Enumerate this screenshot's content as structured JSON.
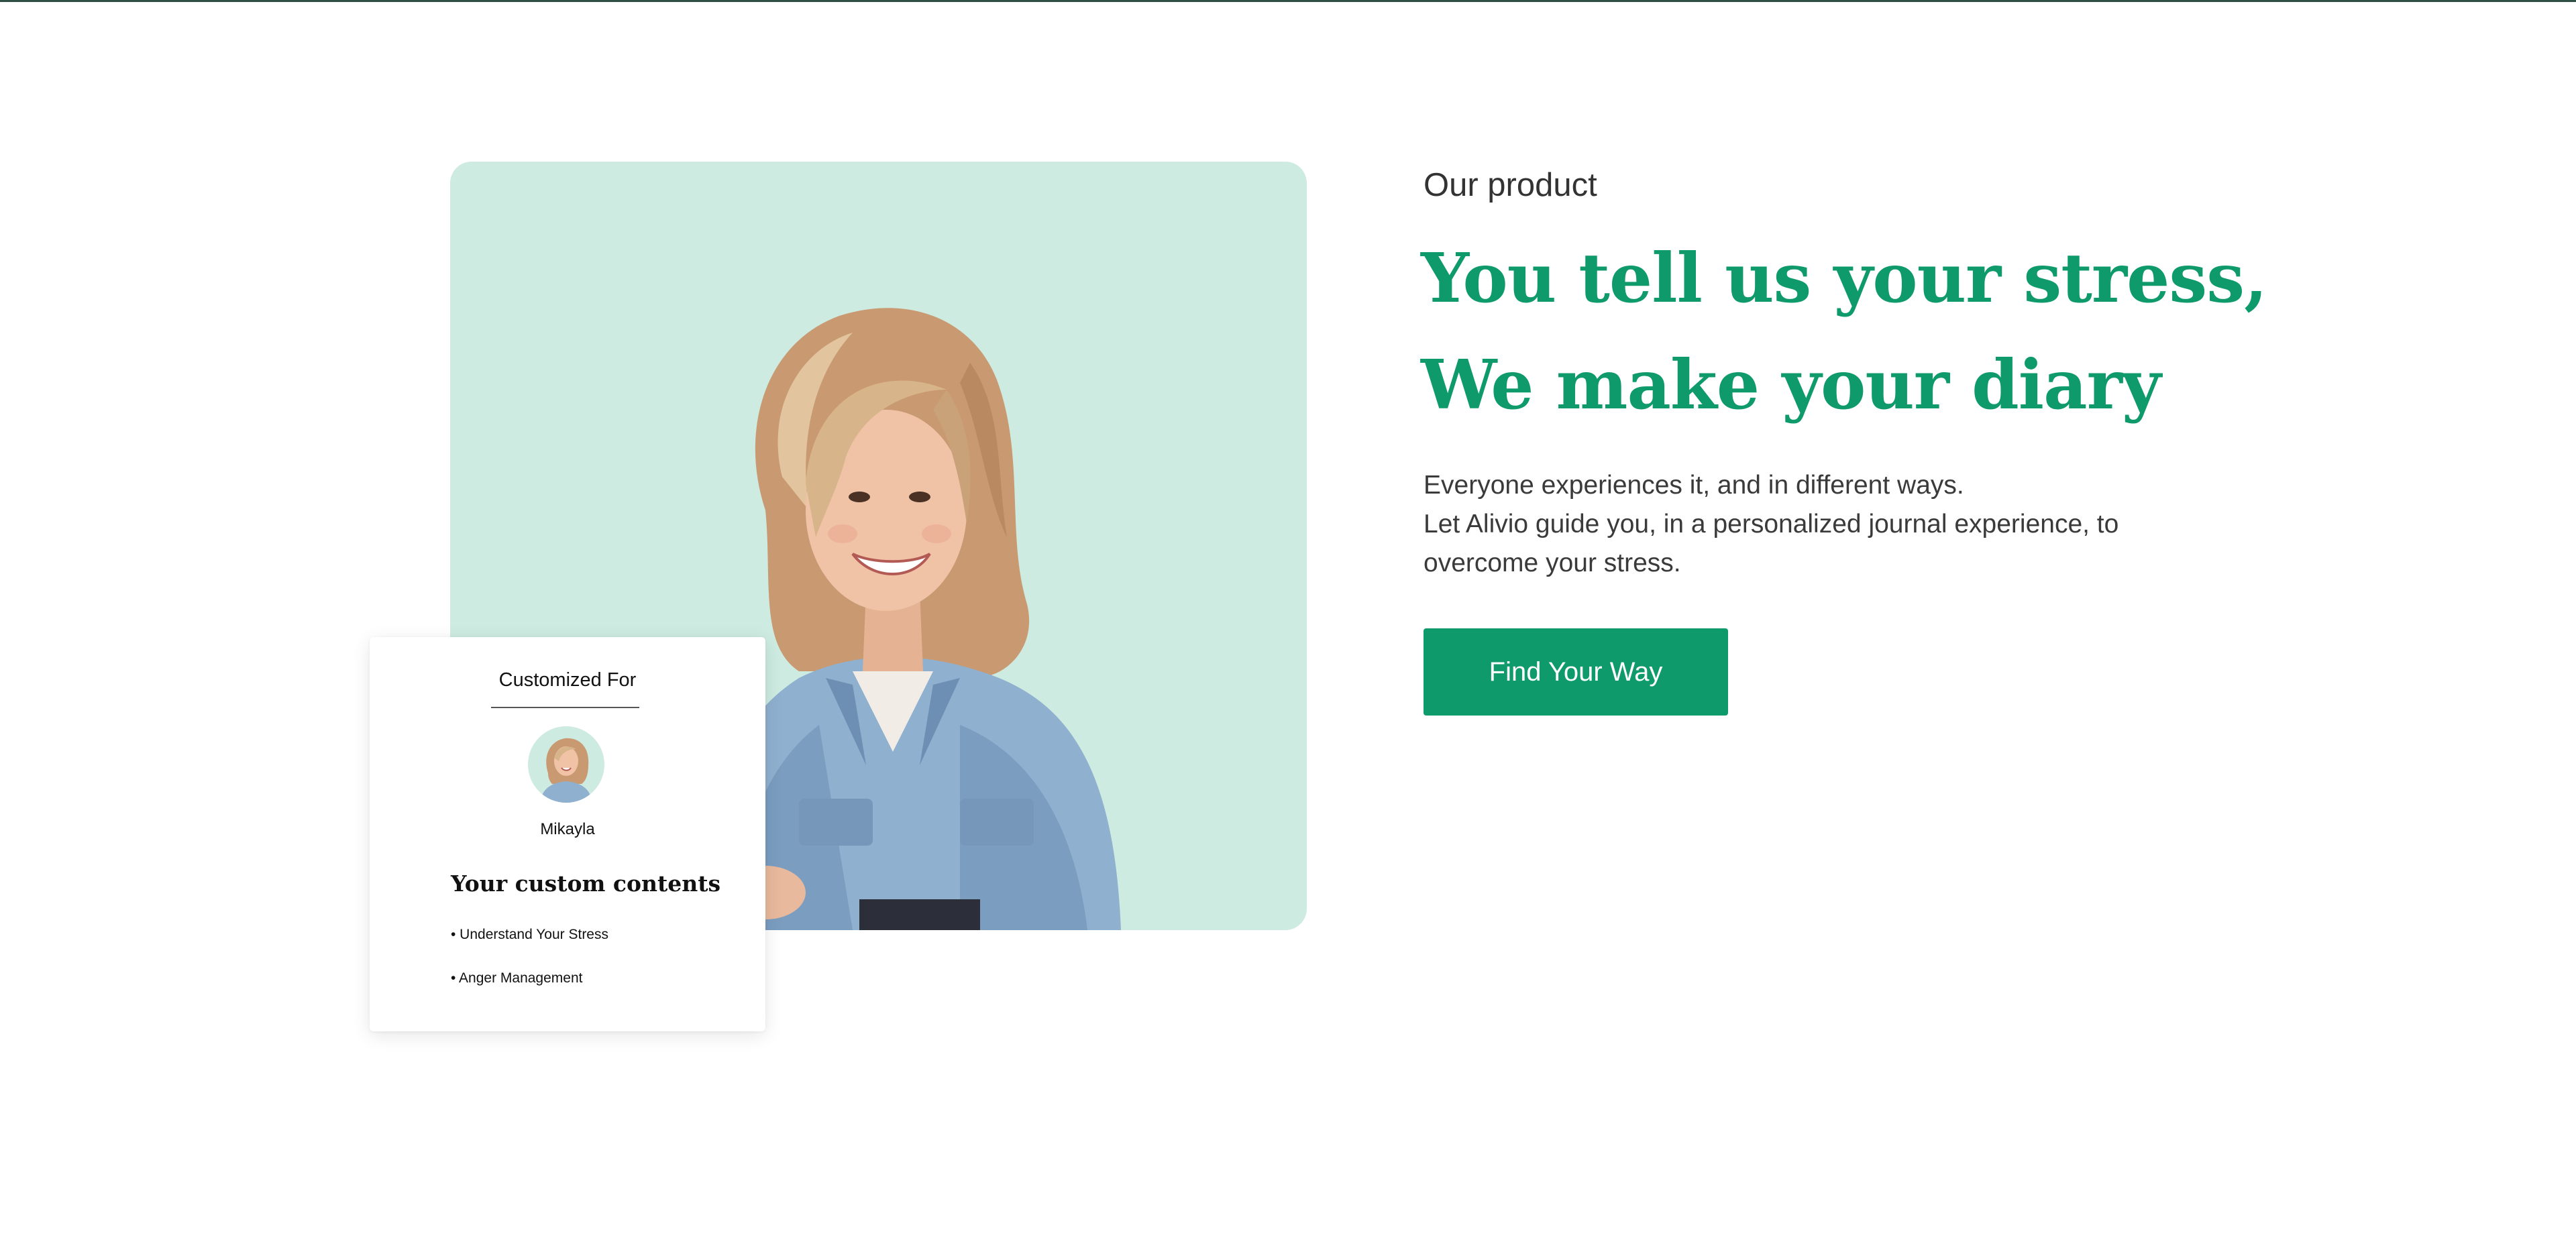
{
  "product_section": {
    "eyebrow": "Our product",
    "headline_line1": "You tell us your stress,",
    "headline_line2": "We make your diary",
    "description_line1": "Everyone experiences it, and in different ways.",
    "description_line2": "Let Alivio guide you, in a personalized journal experience, to overcome your stress.",
    "cta_label": "Find Your Way"
  },
  "custom_card": {
    "title": "Customized For",
    "user_name": "Mikayla",
    "heading": "Your custom contents",
    "items": [
      "• Understand Your Stress",
      "• Anger Management"
    ]
  },
  "colors": {
    "accent": "#0e9a6a",
    "image_background": "#cdebe1",
    "text_dark": "#333333"
  }
}
